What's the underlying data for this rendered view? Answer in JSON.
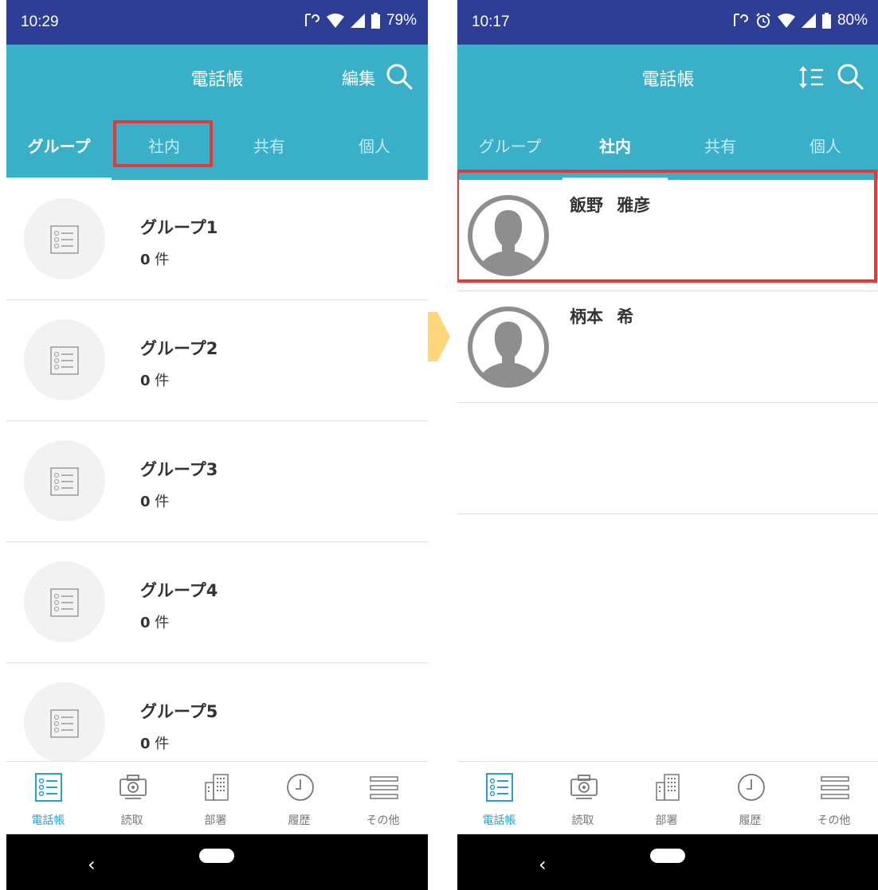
{
  "left": {
    "status": {
      "time": "10:29",
      "battery": "79%"
    },
    "title": "電話帳",
    "edit_label": "編集",
    "tabs": [
      "グループ",
      "社内",
      "共有",
      "個人"
    ],
    "groups": [
      {
        "name": "グループ1",
        "count": "0",
        "unit": "件"
      },
      {
        "name": "グループ2",
        "count": "0",
        "unit": "件"
      },
      {
        "name": "グループ3",
        "count": "0",
        "unit": "件"
      },
      {
        "name": "グループ4",
        "count": "0",
        "unit": "件"
      },
      {
        "name": "グループ5",
        "count": "0",
        "unit": "件"
      }
    ]
  },
  "right": {
    "status": {
      "time": "10:17",
      "battery": "80%"
    },
    "title": "電話帳",
    "tabs": [
      "グループ",
      "社内",
      "共有",
      "個人"
    ],
    "contacts": [
      {
        "name": "飯野 雅彦"
      },
      {
        "name": "柄本 希"
      }
    ]
  },
  "nav": [
    "電話帳",
    "読取",
    "部署",
    "履歴",
    "その他"
  ],
  "colors": {
    "statusbar": "#2e3d96",
    "appbar": "#3aafc8",
    "highlight": "#e53935",
    "arrow": "#ffd77a",
    "nav_active": "#2a9fc7"
  }
}
